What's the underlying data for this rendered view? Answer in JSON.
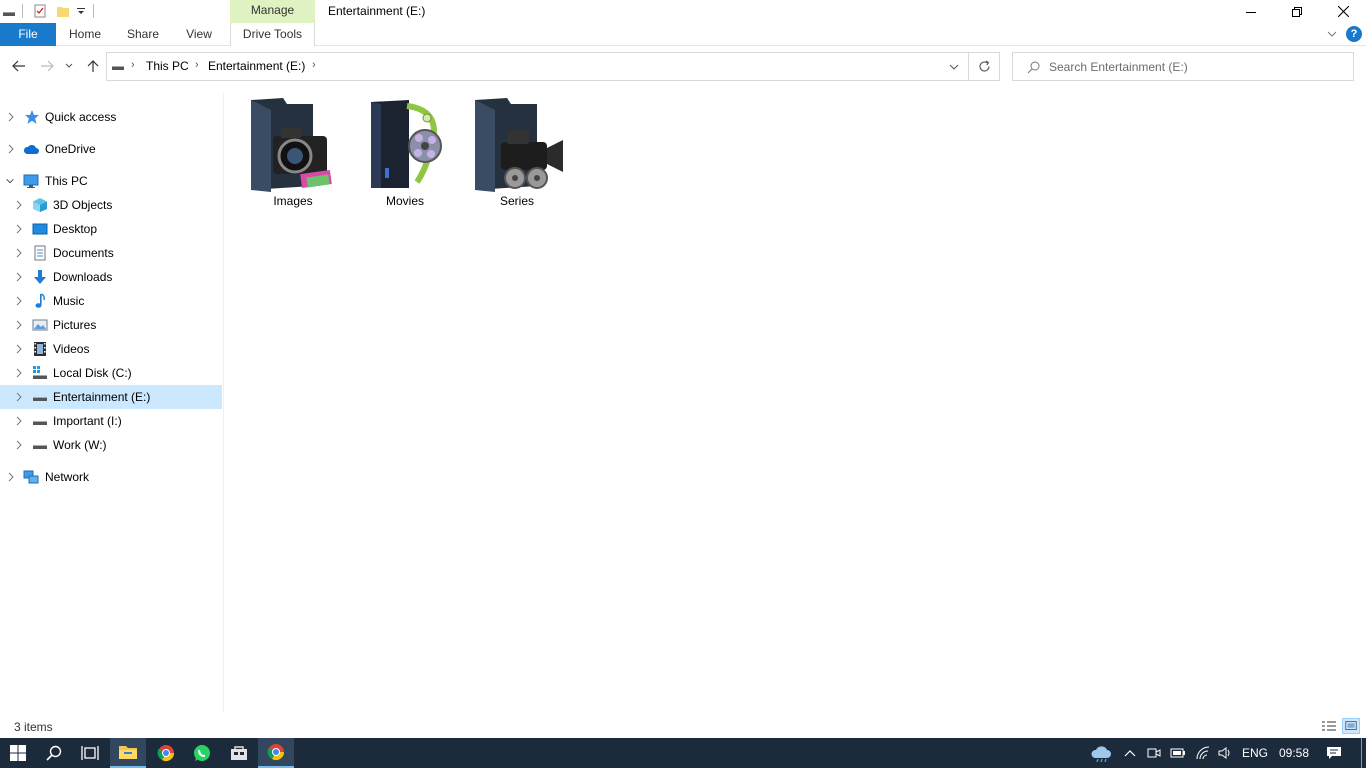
{
  "window": {
    "title": "Entertainment (E:)",
    "contextual_tab_group": "Manage"
  },
  "ribbon": {
    "tabs": [
      "File",
      "Home",
      "Share",
      "View",
      "Drive Tools"
    ]
  },
  "address": {
    "crumbs": [
      "This PC",
      "Entertainment (E:)"
    ]
  },
  "search": {
    "placeholder": "Search Entertainment (E:)"
  },
  "sidebar": {
    "items": [
      {
        "label": "Quick access",
        "icon": "star-icon"
      },
      {
        "label": "OneDrive",
        "icon": "cloud-icon"
      },
      {
        "label": "This PC",
        "icon": "monitor-icon"
      },
      {
        "label": "3D Objects",
        "icon": "cube-icon"
      },
      {
        "label": "Desktop",
        "icon": "desktop-icon"
      },
      {
        "label": "Documents",
        "icon": "document-icon"
      },
      {
        "label": "Downloads",
        "icon": "download-arrow-icon"
      },
      {
        "label": "Music",
        "icon": "music-note-icon"
      },
      {
        "label": "Pictures",
        "icon": "picture-icon"
      },
      {
        "label": "Videos",
        "icon": "film-icon"
      },
      {
        "label": "Local Disk (C:)",
        "icon": "windows-drive-icon"
      },
      {
        "label": "Entertainment (E:)",
        "icon": "drive-icon",
        "selected": true
      },
      {
        "label": "Important (I:)",
        "icon": "drive-icon"
      },
      {
        "label": "Work (W:)",
        "icon": "drive-icon"
      },
      {
        "label": "Network",
        "icon": "network-icon"
      }
    ]
  },
  "content": {
    "items": [
      {
        "label": "Images",
        "icon": "camera-folder-icon"
      },
      {
        "label": "Movies",
        "icon": "film-reel-case-icon"
      },
      {
        "label": "Series",
        "icon": "video-camera-folder-icon"
      }
    ]
  },
  "status": {
    "item_count": "3 items"
  },
  "taskbar": {
    "language": "ENG",
    "time": "09:58"
  },
  "colors": {
    "accent": "#1979ca",
    "selection": "#cce8ff",
    "manage_tab": "#dff2c1",
    "taskbar": "#1c2b3c"
  }
}
